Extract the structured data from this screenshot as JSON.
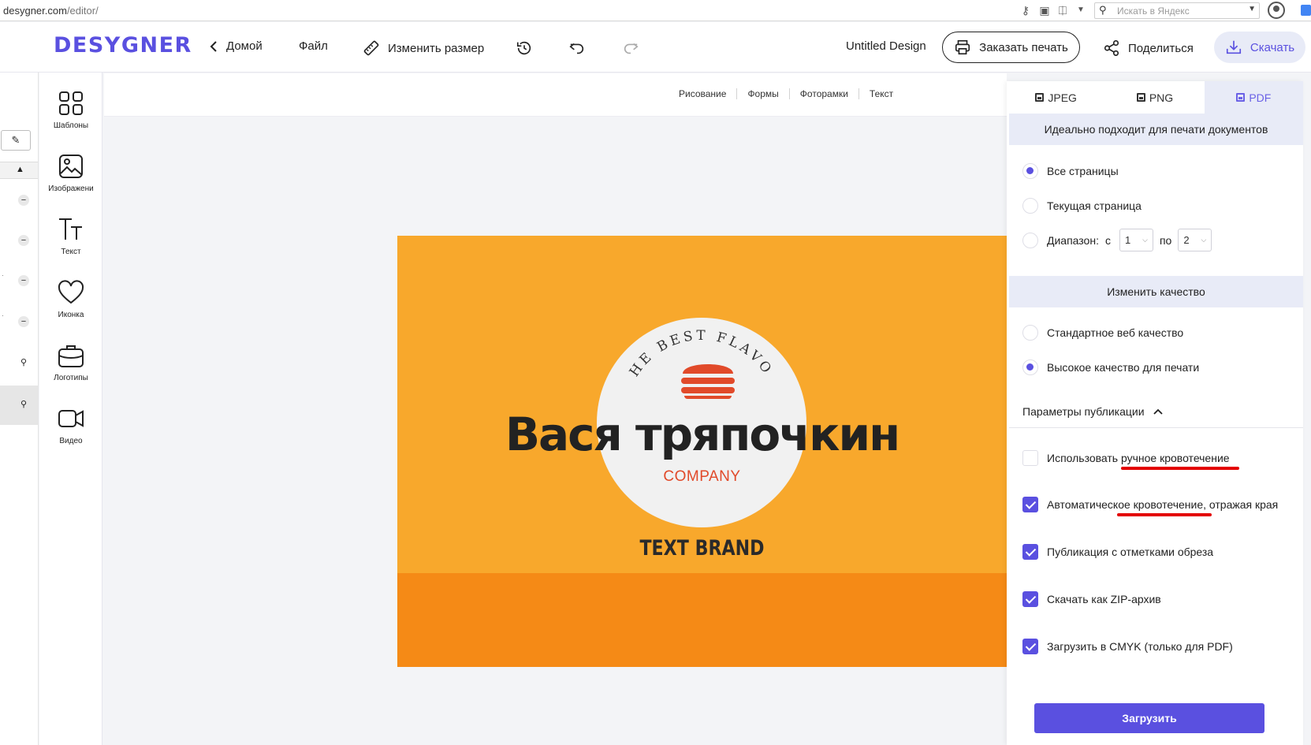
{
  "browser": {
    "url_host": "desygner.com",
    "url_path": "/editor/",
    "search_placeholder": "Искать в Яндекс"
  },
  "header": {
    "logo": "DESYGNER",
    "home": "Домой",
    "file": "Файл",
    "resize": "Изменить размер",
    "design_title": "Untitled Design",
    "print": "Заказать печать",
    "share": "Поделиться",
    "download": "Скачать"
  },
  "tools": [
    {
      "label": "Шаблоны",
      "icon": "templates-icon"
    },
    {
      "label": "Изображени",
      "icon": "image-icon"
    },
    {
      "label": "Текст",
      "icon": "text-icon"
    },
    {
      "label": "Иконка",
      "icon": "heart-icon"
    },
    {
      "label": "Логотипы",
      "icon": "briefcase-icon"
    },
    {
      "label": "Видео",
      "icon": "video-icon"
    }
  ],
  "subtoolbar": [
    "Рисование",
    "Формы",
    "Фоторамки",
    "Текст"
  ],
  "design": {
    "arc_text": "THE BEST FLAVOR",
    "headline": "Вася тряпочкин",
    "company": "COMPANY",
    "brand": "TEXT BRAND",
    "colors": {
      "background": "#f8a82c",
      "bottom_band": "#f58a16",
      "circle": "#f1f1f1",
      "accent": "#e14a2a"
    }
  },
  "download_panel": {
    "tabs": [
      {
        "label": "JPEG",
        "active": false
      },
      {
        "label": "PNG",
        "active": false
      },
      {
        "label": "PDF",
        "active": true
      }
    ],
    "info": "Идеально подходит для печати документов",
    "pages": {
      "all": "Все страницы",
      "current": "Текущая страница",
      "range": "Диапазон:",
      "from_label": "с",
      "from_value": "1",
      "to_label": "по",
      "to_value": "2",
      "selected": "all"
    },
    "quality_header": "Изменить качество",
    "quality": {
      "standard": "Стандартное веб качество",
      "high": "Высокое качество для печати",
      "selected": "high"
    },
    "publish_header": "Параметры публикации",
    "options": [
      {
        "label": "Использовать ручное кровотечение",
        "checked": false
      },
      {
        "label": "Автоматическое кровотечение, отражая края",
        "checked": true
      },
      {
        "label": "Публикация с отметками обреза",
        "checked": true
      },
      {
        "label": "Скачать как ZIP-архив",
        "checked": true
      },
      {
        "label": "Загрузить в CMYK (только для PDF)",
        "checked": true
      }
    ],
    "submit": "Загрузить",
    "accent": "#5a50e0"
  }
}
